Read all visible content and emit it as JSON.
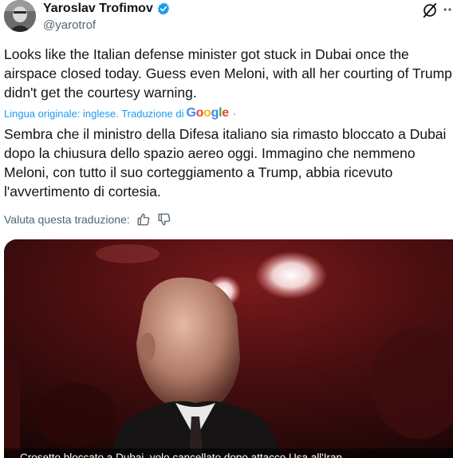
{
  "author": {
    "display_name": "Yaroslav Trofimov",
    "handle": "@yarotrof",
    "verified": true,
    "avatar_icon": "avatar-photo"
  },
  "actions": {
    "grok_icon": "grok-icon",
    "more_icon": "more-options-icon"
  },
  "tweet": {
    "lines": [
      "Looks like the Italian defense minister got stuck in Dubai once the",
      "airspace closed today. Guess even Meloni, with all her courting of Trump,",
      "didn't get the courtesy warning."
    ]
  },
  "translation": {
    "meta_label": "Lingua originale: inglese. Traduzione di",
    "provider": "Google",
    "separator": "·",
    "lines": [
      "Sembra che il ministro della Difesa italiano sia rimasto bloccato a Dubai",
      "dopo la chiusura dello spazio aereo oggi. Immagino che nemmeno",
      "Meloni, con tutto il suo corteggiamento a Trump, abbia ricevuto",
      "l'avvertimento di cortesia."
    ],
    "rate_label": "Valuta questa traduzione:",
    "thumbs_up_icon": "thumbs-up-icon",
    "thumbs_down_icon": "thumbs-down-icon"
  },
  "media": {
    "caption": "Crosetto bloccato a Dubai, volo cancellato dopo attacco Usa all'Iran"
  },
  "colors": {
    "link": "#1d9bf0",
    "secondary_text": "#536471",
    "primary_text": "#0f1419",
    "verified_badge": "#1d9bf0"
  }
}
